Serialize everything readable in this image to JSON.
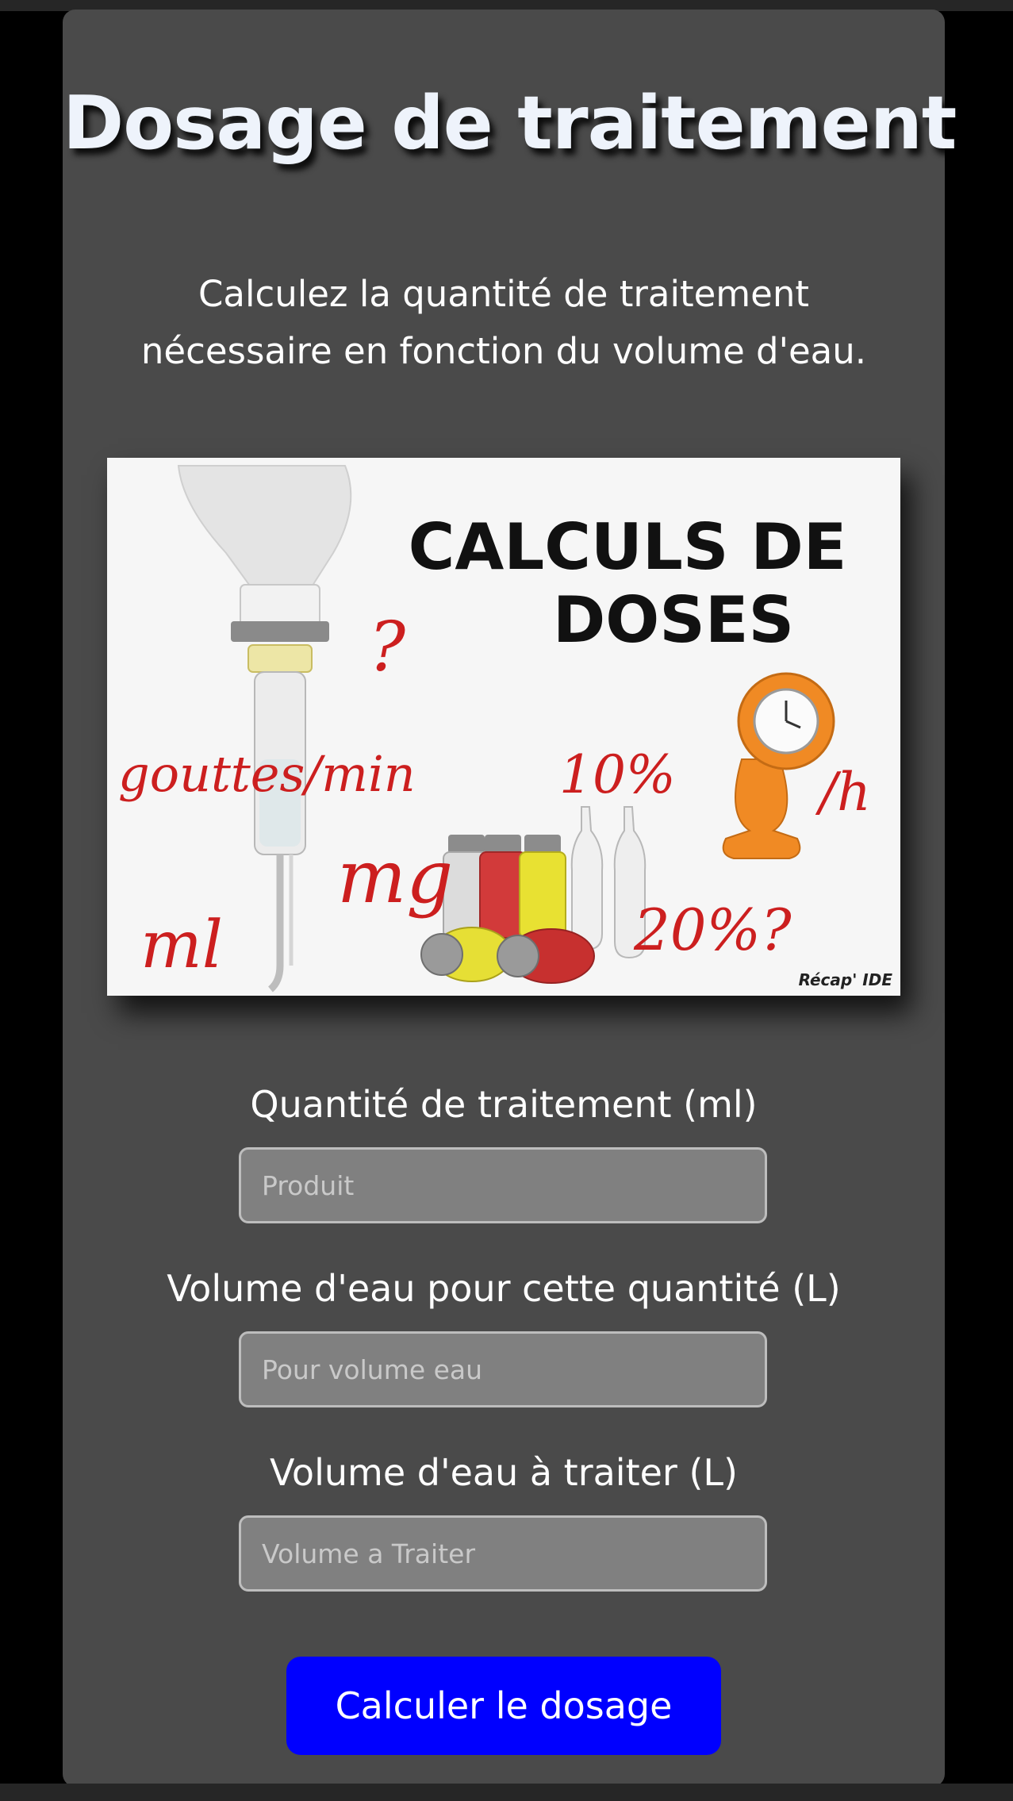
{
  "header": {
    "title": "Dosage de traitement",
    "subtitle": "Calculez la quantité de traitement nécessaire en fonction du volume d'eau."
  },
  "hero_image": {
    "heading_line1": "CALCULS DE",
    "heading_line2": "DOSES",
    "annotations": [
      "?",
      "gouttes/min",
      "10%",
      "/h",
      "mg",
      "ml",
      "20%?"
    ],
    "credit": "Récap' IDE"
  },
  "form": {
    "fields": [
      {
        "label": "Quantité de traitement (ml)",
        "placeholder": "Produit",
        "value": ""
      },
      {
        "label": "Volume d'eau pour cette quantité (L)",
        "placeholder": "Pour volume eau",
        "value": ""
      },
      {
        "label": "Volume d'eau à traiter (L)",
        "placeholder": "Volume a Traiter",
        "value": ""
      }
    ],
    "submit_label": "Calculer le dosage"
  },
  "colors": {
    "page_background": "#000000",
    "card_background": "#4a4a4a",
    "input_background": "#808080",
    "button_background": "#0000ff",
    "handwriting_red": "#cc1f1f",
    "watch_orange": "#f08a24"
  }
}
